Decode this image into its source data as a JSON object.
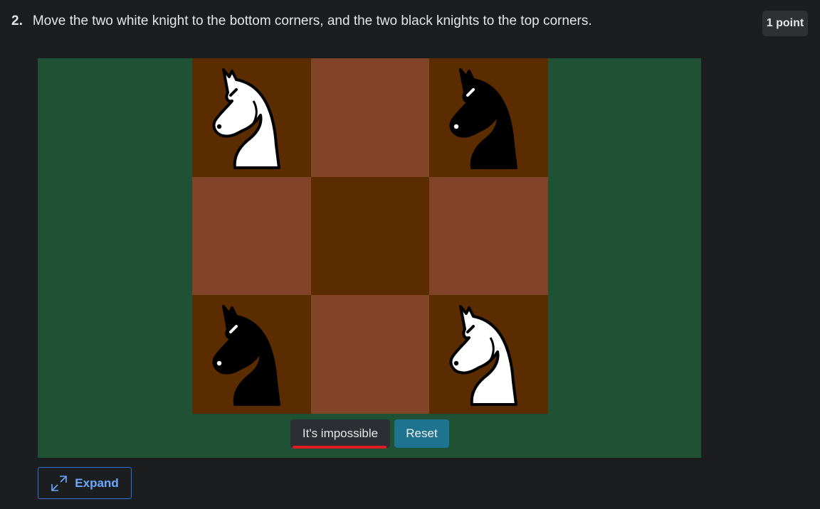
{
  "question": {
    "number": "2.",
    "text": "Move the two white knight to the bottom corners, and the two black knights to the top corners.",
    "points": "1 point"
  },
  "board": {
    "rows": [
      [
        {
          "color": "dark",
          "piece": "white-knight"
        },
        {
          "color": "light",
          "piece": ""
        },
        {
          "color": "dark",
          "piece": "black-knight"
        }
      ],
      [
        {
          "color": "light",
          "piece": ""
        },
        {
          "color": "dark",
          "piece": ""
        },
        {
          "color": "light",
          "piece": ""
        }
      ],
      [
        {
          "color": "dark",
          "piece": "black-knight"
        },
        {
          "color": "light",
          "piece": ""
        },
        {
          "color": "dark",
          "piece": "white-knight"
        }
      ]
    ],
    "colors": {
      "dark": "#5c2c01",
      "light": "#814428",
      "panel": "#1f5235"
    }
  },
  "buttons": {
    "impossible": "It's impossible",
    "reset": "Reset",
    "expand": "Expand"
  },
  "icons": {
    "expand": "expand-arrows-icon",
    "white_knight": "white-knight-icon",
    "black_knight": "black-knight-icon"
  }
}
